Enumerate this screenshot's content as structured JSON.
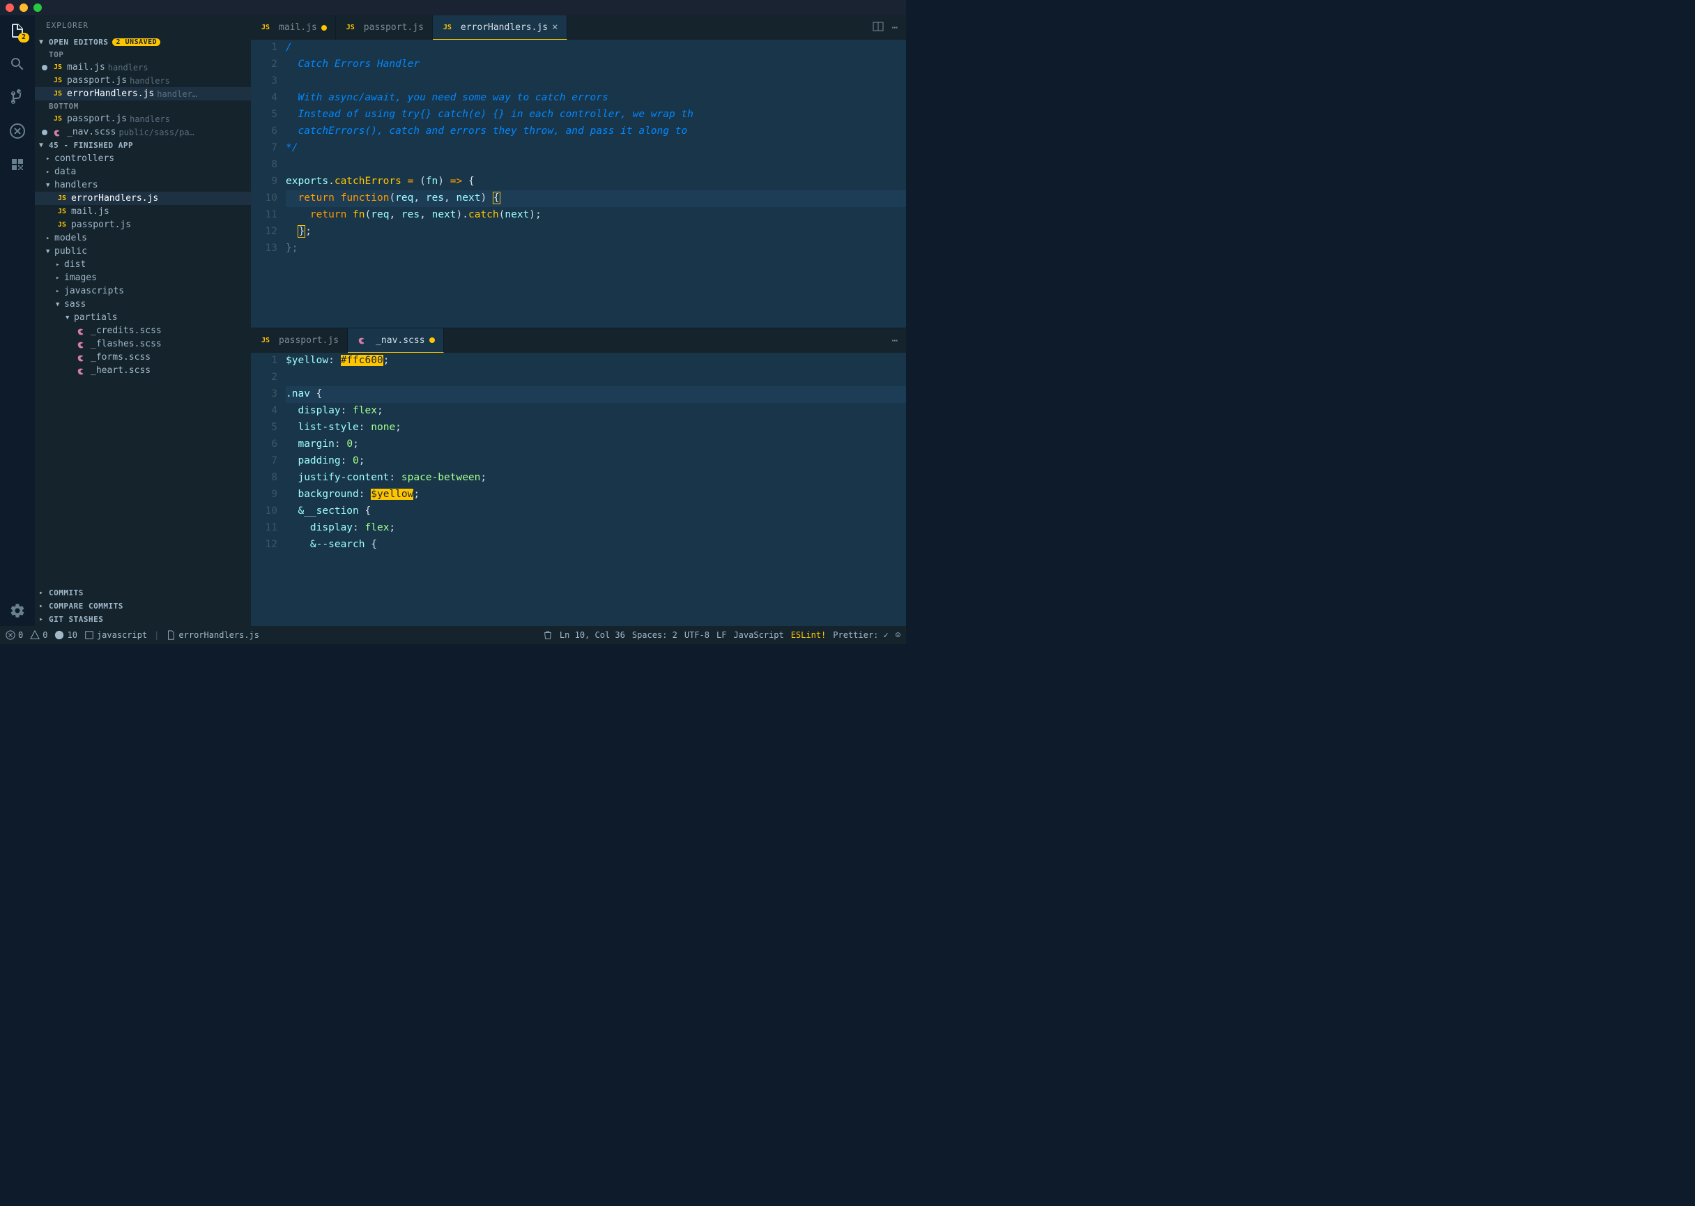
{
  "titlebar": {},
  "activity": {
    "badge": "2"
  },
  "sidebar": {
    "title": "EXPLORER",
    "openEditors": {
      "label": "OPEN EDITORS",
      "unsaved": "2 UNSAVED",
      "groups": [
        {
          "label": "TOP",
          "items": [
            {
              "dirty": true,
              "icon": "js",
              "name": "mail.js",
              "path": "handlers"
            },
            {
              "dirty": false,
              "icon": "js",
              "name": "passport.js",
              "path": "handlers"
            },
            {
              "dirty": false,
              "icon": "js",
              "name": "errorHandlers.js",
              "path": "handler…",
              "selected": true
            }
          ]
        },
        {
          "label": "BOTTOM",
          "items": [
            {
              "dirty": false,
              "icon": "js",
              "name": "passport.js",
              "path": "handlers"
            },
            {
              "dirty": true,
              "icon": "scss",
              "name": "_nav.scss",
              "path": "public/sass/pa…"
            }
          ]
        }
      ]
    },
    "project": {
      "label": "45 - FINISHED APP",
      "tree": [
        {
          "depth": 0,
          "type": "folder",
          "name": "controllers",
          "open": false
        },
        {
          "depth": 0,
          "type": "folder",
          "name": "data",
          "open": false
        },
        {
          "depth": 0,
          "type": "folder",
          "name": "handlers",
          "open": true
        },
        {
          "depth": 1,
          "type": "file",
          "icon": "js",
          "name": "errorHandlers.js",
          "selected": true
        },
        {
          "depth": 1,
          "type": "file",
          "icon": "js",
          "name": "mail.js"
        },
        {
          "depth": 1,
          "type": "file",
          "icon": "js",
          "name": "passport.js"
        },
        {
          "depth": 0,
          "type": "folder",
          "name": "models",
          "open": false
        },
        {
          "depth": 0,
          "type": "folder",
          "name": "public",
          "open": true
        },
        {
          "depth": 1,
          "type": "folder",
          "name": "dist",
          "open": false
        },
        {
          "depth": 1,
          "type": "folder",
          "name": "images",
          "open": false
        },
        {
          "depth": 1,
          "type": "folder",
          "name": "javascripts",
          "open": false
        },
        {
          "depth": 1,
          "type": "folder",
          "name": "sass",
          "open": true
        },
        {
          "depth": 2,
          "type": "folder",
          "name": "partials",
          "open": true
        },
        {
          "depth": 3,
          "type": "file",
          "icon": "scss",
          "name": "_credits.scss"
        },
        {
          "depth": 3,
          "type": "file",
          "icon": "scss",
          "name": "_flashes.scss"
        },
        {
          "depth": 3,
          "type": "file",
          "icon": "scss",
          "name": "_forms.scss"
        },
        {
          "depth": 3,
          "type": "file",
          "icon": "scss",
          "name": "_heart.scss"
        }
      ]
    },
    "panels": [
      "COMMITS",
      "COMPARE COMMITS",
      "GIT STASHES"
    ]
  },
  "editorTop": {
    "tabs": [
      {
        "icon": "js",
        "name": "mail.js",
        "dirty": true,
        "active": false
      },
      {
        "icon": "js",
        "name": "passport.js",
        "dirty": false,
        "active": false
      },
      {
        "icon": "js",
        "name": "errorHandlers.js",
        "dirty": false,
        "active": true,
        "closeable": true
      }
    ],
    "lines": [
      {
        "n": 1,
        "html": "<span class='c-comment'>/</span>"
      },
      {
        "n": 2,
        "html": "  <span class='c-comment'>Catch Errors Handler</span>"
      },
      {
        "n": 3,
        "html": ""
      },
      {
        "n": 4,
        "html": "  <span class='c-comment'>With async/await, you need some way to catch errors</span>"
      },
      {
        "n": 5,
        "html": "  <span class='c-comment'>Instead of using try{} catch(e) {} in each controller, we wrap th</span>"
      },
      {
        "n": 6,
        "html": "  <span class='c-comment'>catchErrors(), catch and errors they throw, and pass it along to</span>"
      },
      {
        "n": 7,
        "html": "<span class='c-comment'>*/</span>"
      },
      {
        "n": 8,
        "html": ""
      },
      {
        "n": 9,
        "html": "<span class='c-var'>exports</span><span class='c-punc'>.</span><span class='c-fn'>catchErrors</span> <span class='c-op'>=</span> <span class='c-punc'>(</span><span class='c-var'>fn</span><span class='c-punc'>)</span> <span class='c-op'>=&gt;</span> <span class='c-punc'>{</span>"
      },
      {
        "n": 10,
        "hl": true,
        "html": "  <span class='c-kw'>return</span> <span class='c-kw'>function</span><span class='c-punc'>(</span><span class='c-var'>req</span><span class='c-punc'>,</span> <span class='c-var'>res</span><span class='c-punc'>,</span> <span class='c-var'>next</span><span class='c-punc'>)</span> <span class='bracket-match'>{</span>"
      },
      {
        "n": 11,
        "html": "    <span class='c-kw'>return</span> <span class='c-fn'>fn</span><span class='c-punc'>(</span><span class='c-var'>req</span><span class='c-punc'>,</span> <span class='c-var'>res</span><span class='c-punc'>,</span> <span class='c-var'>next</span><span class='c-punc'>).</span><span class='c-fn'>catch</span><span class='c-punc'>(</span><span class='c-var'>next</span><span class='c-punc'>);</span>"
      },
      {
        "n": 12,
        "html": "  <span class='bracket-match'>}</span><span class='c-punc'>;</span>"
      },
      {
        "n": 13,
        "html": "<span class='c-punc' style='opacity:.4'>};</span>"
      }
    ]
  },
  "editorBottom": {
    "tabs": [
      {
        "icon": "js",
        "name": "passport.js",
        "dirty": false,
        "active": false
      },
      {
        "icon": "scss",
        "name": "_nav.scss",
        "dirty": true,
        "active": true
      }
    ],
    "lines": [
      {
        "n": 1,
        "html": "<span class='c-var'>$yellow</span><span class='c-punc'>:</span> <span class='c-hex'>#ffc600</span><span class='c-punc'>;</span>"
      },
      {
        "n": 2,
        "html": ""
      },
      {
        "n": 3,
        "hl": true,
        "html": "<span class='c-sel'>.nav</span> <span class='c-punc'>{</span>"
      },
      {
        "n": 4,
        "html": "  <span class='c-prop'>display</span><span class='c-punc'>:</span> <span class='c-val'>flex</span><span class='c-punc'>;</span>"
      },
      {
        "n": 5,
        "html": "  <span class='c-prop'>list-style</span><span class='c-punc'>:</span> <span class='c-val'>none</span><span class='c-punc'>;</span>"
      },
      {
        "n": 6,
        "html": "  <span class='c-prop'>margin</span><span class='c-punc'>:</span> <span class='c-val'>0</span><span class='c-punc'>;</span>"
      },
      {
        "n": 7,
        "html": "  <span class='c-prop'>padding</span><span class='c-punc'>:</span> <span class='c-val'>0</span><span class='c-punc'>;</span>"
      },
      {
        "n": 8,
        "html": "  <span class='c-prop'>justify-content</span><span class='c-punc'>:</span> <span class='c-val'>space-between</span><span class='c-punc'>;</span>"
      },
      {
        "n": 9,
        "html": "  <span class='c-prop'>background</span><span class='c-punc'>:</span> <span class='c-yel'>$yellow</span><span class='c-punc'>;</span>"
      },
      {
        "n": 10,
        "html": "  <span class='c-sel'>&amp;__section</span> <span class='c-punc'>{</span>"
      },
      {
        "n": 11,
        "html": "    <span class='c-prop'>display</span><span class='c-punc'>:</span> <span class='c-val'>flex</span><span class='c-punc'>;</span>"
      },
      {
        "n": 12,
        "html": "    <span class='c-sel'>&amp;--search</span> <span class='c-punc'>{</span>"
      }
    ]
  },
  "status": {
    "errors": "0",
    "warnings": "0",
    "info": "10",
    "lang1": "javascript",
    "file": "errorHandlers.js",
    "pos": "Ln 10, Col 36",
    "spaces": "Spaces: 2",
    "enc": "UTF-8",
    "eol": "LF",
    "lang2": "JavaScript",
    "eslint": "ESLint!",
    "prettier": "Prettier: ✓"
  }
}
